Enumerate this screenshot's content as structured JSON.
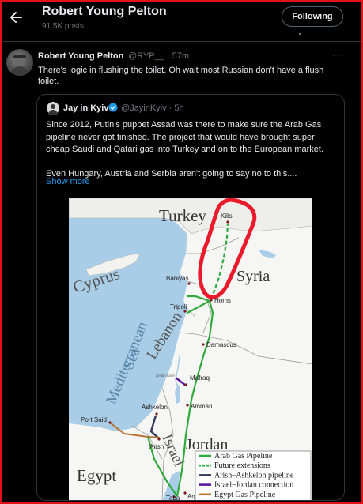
{
  "header": {
    "title": "Robert Young Pelton",
    "posts": "91.5K posts",
    "follow_label": "Following"
  },
  "tweet": {
    "author": "Robert Young Pelton",
    "meta": "@RYP__ · 57m",
    "more": "···",
    "text": "There's logic in flushing the toilet. Oh wait most Russian don't have a flush toilet."
  },
  "quote": {
    "author": "Jay in Kyiv",
    "meta": "@JayinKyiv · 5h",
    "paragraph1": "Since 2012, Putin's puppet Assad was there to make sure the Arab Gas pipeline never got finished. The project that would have brought super cheap Saudi and Qatari gas into Turkey and on to the European market.",
    "paragraph2": "Even Hungary, Austria and Serbia aren't going to say no to this....",
    "show_more": "Show more"
  },
  "map": {
    "regions": {
      "turkey": "Turkey",
      "syria": "Syria",
      "cyprus": "Cyprus",
      "sea_line1": "Mediterranean",
      "sea_line2": "Sea",
      "lebanon": "Lebanon",
      "israel": "Israel",
      "jordan": "Jordan",
      "egypt": "Egypt",
      "jordan_river": "Jordan River"
    },
    "cities": {
      "kilis": "Kilis",
      "baniyas": "Baniyas",
      "tripoli": "Tripoli",
      "homs": "Homs",
      "damascus": "Damascus",
      "mafraq": "Mafraq",
      "amman": "Amman",
      "ashkelon": "Ashkelon",
      "port_said": "Port Said",
      "arish": "Arish",
      "taba": "Taba",
      "aqaba": "Aqaba"
    },
    "legend": [
      {
        "label": "Arab Gas Pipeline",
        "color": "#2eaa3a",
        "style": "solid"
      },
      {
        "label": "Future extensions",
        "color": "#2eaa3a",
        "style": "dashed"
      },
      {
        "label": "Arish–Ashkelon pipeline",
        "color": "#333a5c",
        "style": "solid"
      },
      {
        "label": "Israel–Jordan connection",
        "color": "#5a1aa3",
        "style": "solid"
      },
      {
        "label": "Egypt Gas Pipeline",
        "color": "#b87333",
        "style": "solid"
      }
    ],
    "highlight_color": "#e81a2b"
  }
}
